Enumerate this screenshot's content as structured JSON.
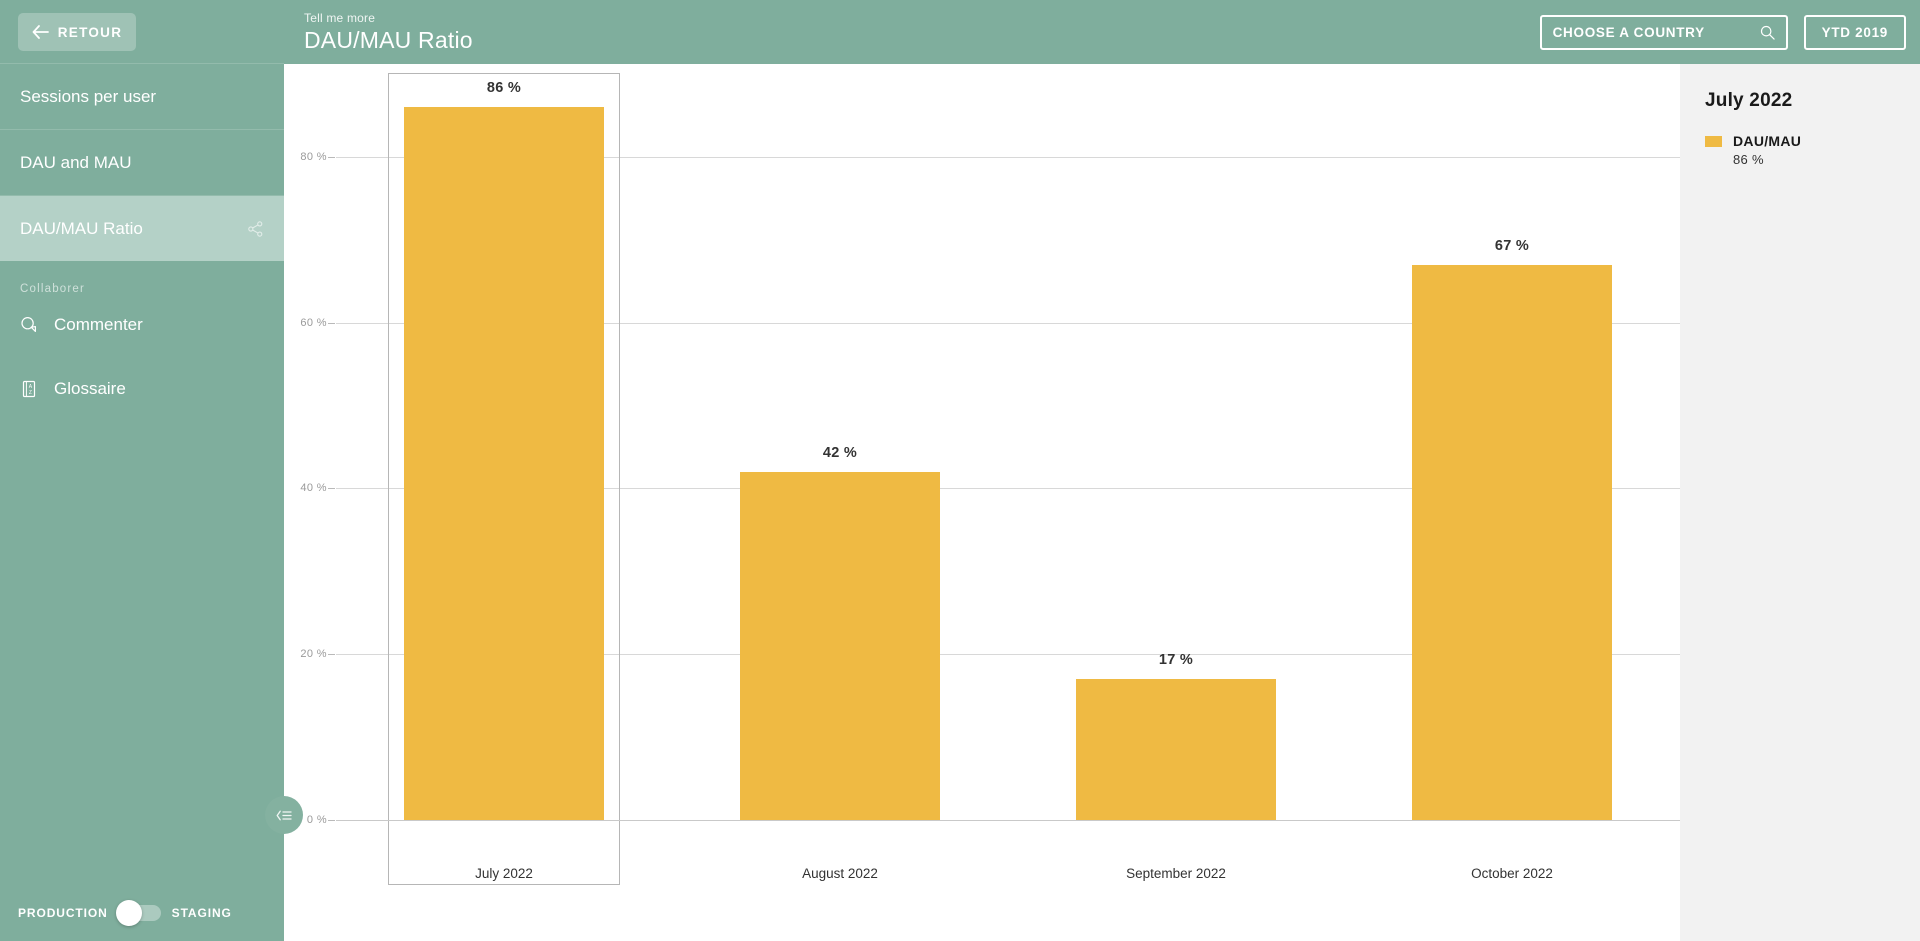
{
  "sidebar": {
    "back_button": {
      "label": "RETOUR",
      "icon": "arrow-left-icon"
    },
    "nav_items": [
      {
        "label": "Sessions per user",
        "active": false
      },
      {
        "label": "DAU and MAU",
        "active": false
      },
      {
        "label": "DAU/MAU Ratio",
        "active": true,
        "action_icon": "share-icon"
      }
    ],
    "section_label": "Collaborer",
    "tools": [
      {
        "label": "Commenter",
        "icon": "comment-bubble-icon"
      },
      {
        "label": "Glossaire",
        "icon": "glossary-book-icon"
      }
    ],
    "environment_toggle": {
      "left_label": "PRODUCTION",
      "right_label": "STAGING",
      "selected": "PRODUCTION"
    },
    "collapse_button_icon": "collapse-sidebar-icon"
  },
  "header": {
    "eyebrow": "Tell me more",
    "title": "DAU/MAU Ratio",
    "country_select": {
      "value": "CHOOSE A COUNTRY",
      "icon": "search-icon"
    },
    "period_button": {
      "label": "YTD 2019"
    }
  },
  "legend_panel": {
    "title": "July 2022",
    "series_name": "DAU/MAU",
    "series_value": "86 %",
    "swatch_color": "#EFBA43"
  },
  "chart_data": {
    "type": "bar",
    "title": "DAU/MAU Ratio",
    "categories": [
      "July 2022",
      "August 2022",
      "September 2022",
      "October 2022"
    ],
    "values": [
      86,
      42,
      17,
      67
    ],
    "value_labels": [
      "86 %",
      "42 %",
      "17 %",
      "67 %"
    ],
    "series": [
      {
        "name": "DAU/MAU",
        "values": [
          86,
          42,
          17,
          67
        ],
        "color": "#EFBA43"
      }
    ],
    "xlabel": "",
    "ylabel": "",
    "ylim": [
      0,
      90
    ],
    "yticks": [
      0,
      20,
      40,
      60,
      80
    ],
    "ytick_labels": [
      "0 %",
      "20 %",
      "40 %",
      "60 %",
      "80 %"
    ],
    "grid": true,
    "legend_position": "right",
    "highlighted_category": "July 2022"
  }
}
